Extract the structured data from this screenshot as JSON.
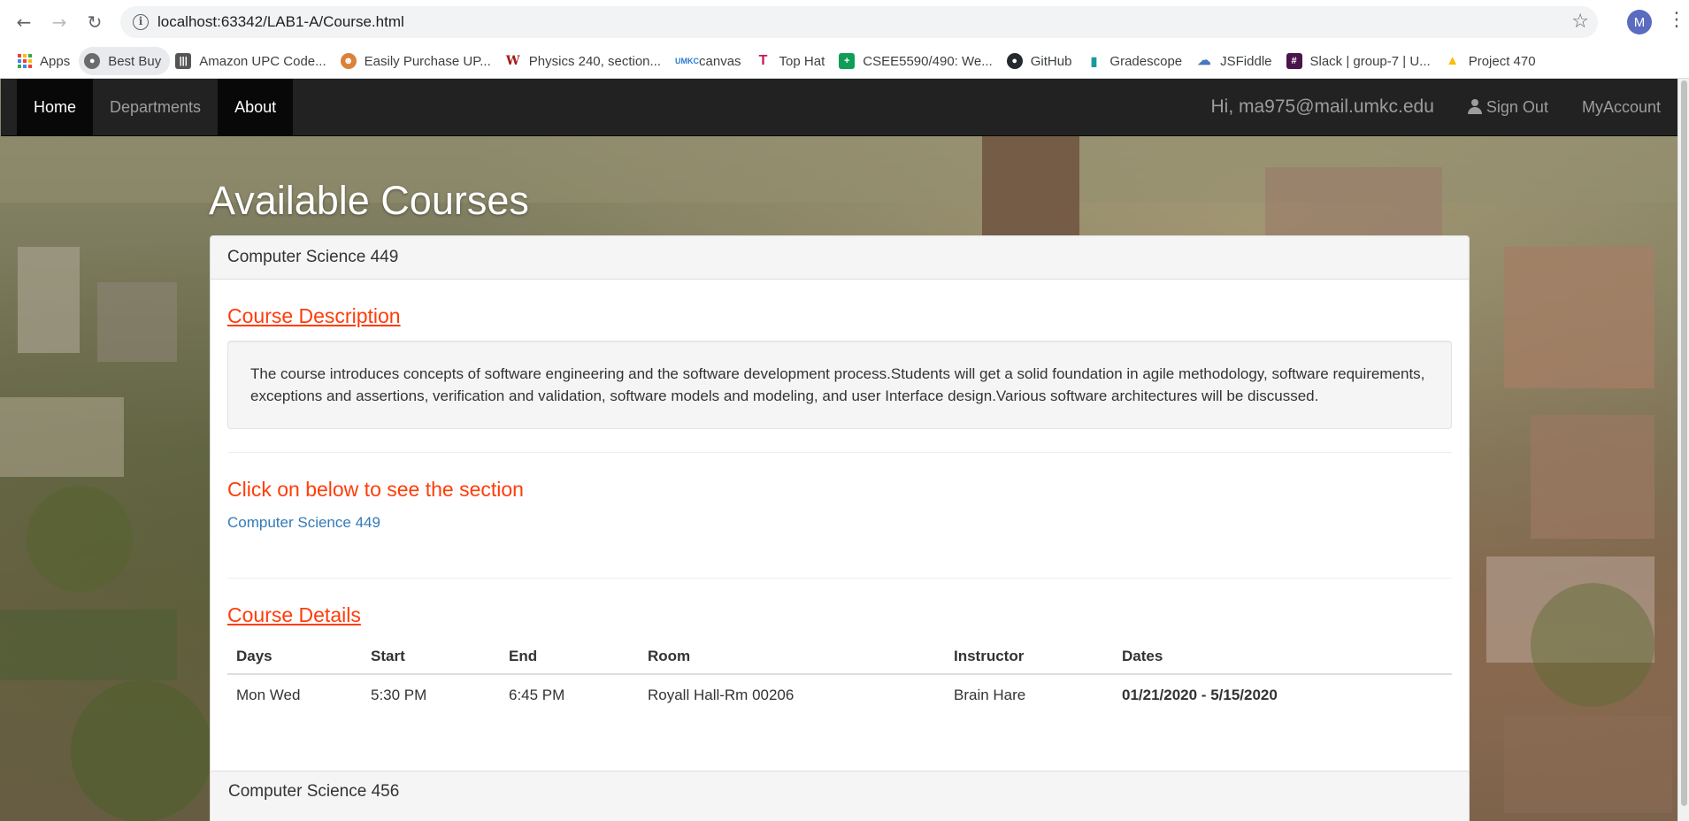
{
  "browser": {
    "url": "localhost:63342/LAB1-A/Course.html",
    "profile_initial": "M",
    "bookmarks": [
      {
        "label": "Apps",
        "icon": "apps-grid-icon"
      },
      {
        "label": "Best Buy",
        "icon": "globe-icon"
      },
      {
        "label": "Amazon UPC Code...",
        "icon": "barcode-icon"
      },
      {
        "label": "Easily Purchase UP...",
        "icon": "cartoon-icon"
      },
      {
        "label": "Physics 240, section...",
        "icon": "wiley-icon"
      },
      {
        "label": "canvas",
        "icon": "umkc-icon"
      },
      {
        "label": "Top Hat",
        "icon": "tophat-icon"
      },
      {
        "label": "CSEE5590/490: We...",
        "icon": "sheets-icon"
      },
      {
        "label": "GitHub",
        "icon": "github-icon"
      },
      {
        "label": "Gradescope",
        "icon": "gradescope-icon"
      },
      {
        "label": "JSFiddle",
        "icon": "jsfiddle-icon"
      },
      {
        "label": "Slack | group-7 | U...",
        "icon": "slack-icon"
      },
      {
        "label": "Project 470",
        "icon": "drive-icon"
      }
    ]
  },
  "navbar": {
    "home": "Home",
    "departments": "Departments",
    "about": "About",
    "greeting": "Hi, ma975@mail.umkc.edu",
    "sign_out": "Sign Out",
    "my_account": "MyAccount"
  },
  "page": {
    "heading": "Available Courses"
  },
  "course": {
    "panel_title": "Computer Science 449",
    "description_title": "Course Description",
    "description": "The course introduces concepts of software engineering and the software development process.Students will get a solid foundation in agile methodology, software requirements, exceptions and assertions, verification and validation, software models and modeling, and user Interface design.Various software architectures will be discussed.",
    "section_title": "Click on below to see the section",
    "section_link": "Computer Science 449",
    "details_title": "Course Details",
    "table": {
      "headers": [
        "Days",
        "Start",
        "End",
        "Room",
        "Instructor",
        "Dates"
      ],
      "rows": [
        [
          "Mon Wed",
          "5:30 PM",
          "6:45 PM",
          "Royall Hall-Rm 00206",
          "Brain Hare",
          "01/21/2020 - 5/15/2020"
        ]
      ]
    }
  },
  "next_course": {
    "panel_title": "Computer Science 456"
  }
}
